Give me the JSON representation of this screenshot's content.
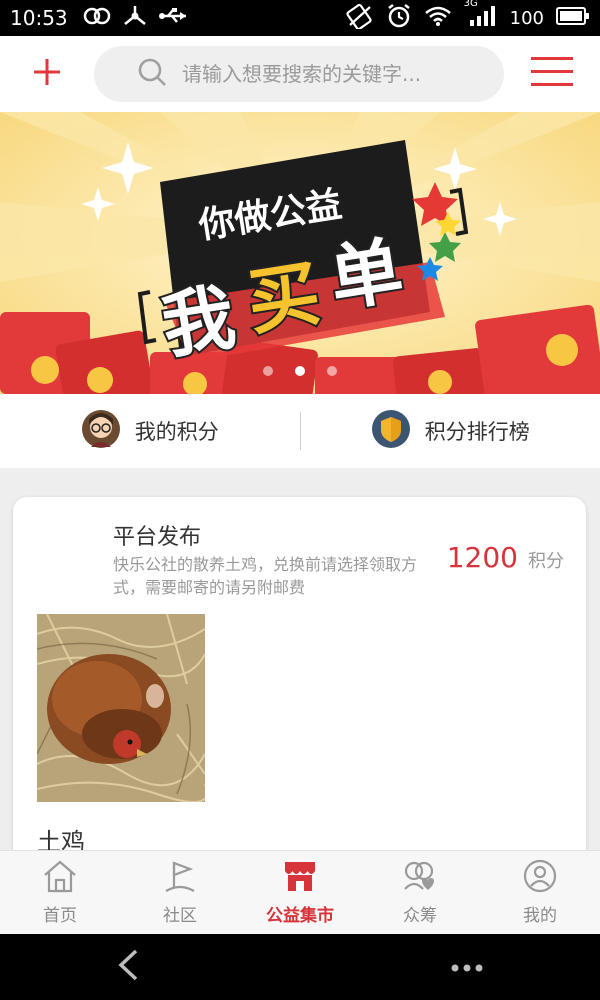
{
  "status_bar": {
    "time": "10:53",
    "battery_percent": "100",
    "network_type": "3G",
    "icons": [
      "link-icon",
      "usb-icon",
      "usb-debug-icon",
      "no-sim-icon",
      "alarm-icon",
      "wifi-icon",
      "signal-icon",
      "battery-icon"
    ]
  },
  "header": {
    "add_icon": "plus-icon",
    "search_placeholder": "请输入想要搜索的关键字...",
    "menu_icon": "hamburger-icon",
    "accent_color": "#e2373c"
  },
  "banner": {
    "line1": "你做公益",
    "line2_a": "我",
    "line2_b": "买",
    "line2_c": "单",
    "slides_total": 3,
    "slide_active": 2
  },
  "score_row": {
    "my_points": "我的积分",
    "ranking": "积分排行榜"
  },
  "product": {
    "publisher": "平台发布",
    "description": "快乐公社的散养土鸡，兑换前请选择领取方式，需要邮寄的请另附邮费",
    "points": "1200",
    "points_unit": "积分",
    "title": "土鸡",
    "price_color": "#d6333a"
  },
  "tab_bar": {
    "tabs": [
      {
        "label": "首页",
        "icon": "home-icon",
        "active": false
      },
      {
        "label": "社区",
        "icon": "flag-icon",
        "active": false
      },
      {
        "label": "公益集市",
        "icon": "store-icon",
        "active": true
      },
      {
        "label": "众筹",
        "icon": "crowdfunding-icon",
        "active": false
      },
      {
        "label": "我的",
        "icon": "user-icon",
        "active": false
      }
    ],
    "active_color": "#d6333a"
  },
  "nav_bar": {
    "icons": [
      "back-icon",
      "more-icon"
    ]
  }
}
